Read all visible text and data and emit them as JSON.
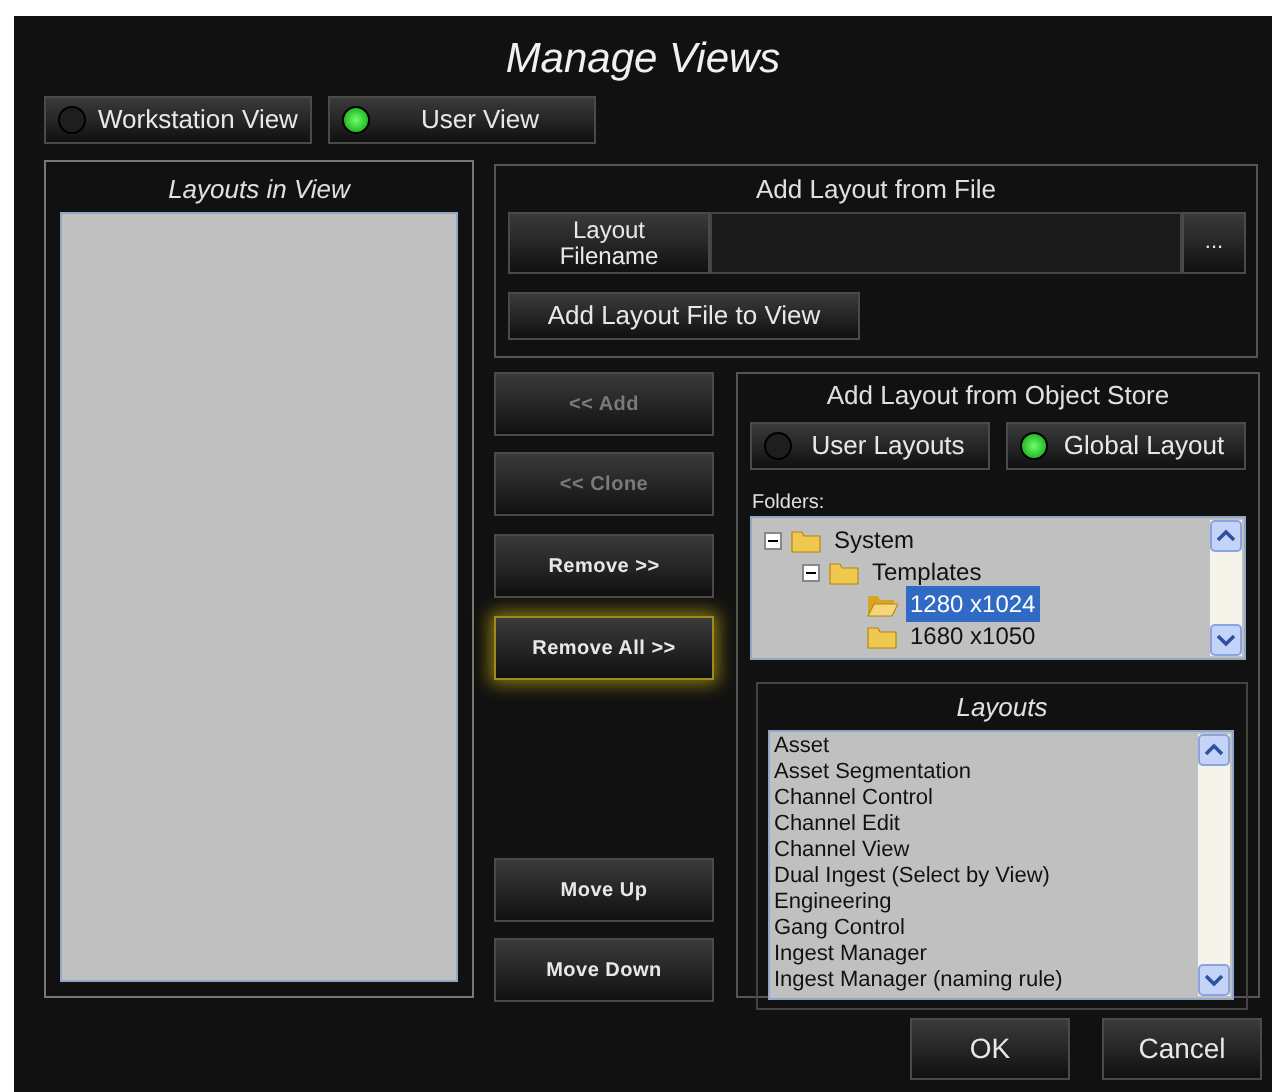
{
  "window": {
    "title": "Manage Views"
  },
  "view_toggles": [
    {
      "label": "Workstation View",
      "on": false
    },
    {
      "label": "User View",
      "on": true
    }
  ],
  "layouts_in_view": {
    "title": "Layouts in View"
  },
  "add_from_file": {
    "title": "Add Layout from File",
    "filename_button": "Layout Filename",
    "browse_button": "...",
    "add_button": "Add Layout File to View"
  },
  "action_buttons": [
    {
      "label": "<< Add",
      "disabled": true,
      "focused": false
    },
    {
      "label": "<< Clone",
      "disabled": true,
      "focused": false
    },
    {
      "label": "Remove >>",
      "disabled": false,
      "focused": false
    },
    {
      "label": "Remove All >>",
      "disabled": false,
      "focused": true
    },
    {
      "label": "Move Up",
      "disabled": false,
      "focused": false
    },
    {
      "label": "Move Down",
      "disabled": false,
      "focused": false
    }
  ],
  "object_store": {
    "title": "Add Layout from Object Store",
    "source_toggles": [
      {
        "label": "User Layouts",
        "on": false
      },
      {
        "label": "Global Layout",
        "on": true
      }
    ],
    "folders_label": "Folders:",
    "folders": [
      {
        "label": "System",
        "expanded": true,
        "selected": false,
        "children": [
          {
            "label": "Templates",
            "expanded": true,
            "selected": false,
            "children": [
              {
                "label": "1280 x1024",
                "selected": true
              },
              {
                "label": "1680 x1050",
                "selected": false
              }
            ]
          }
        ]
      }
    ],
    "layouts_title": "Layouts",
    "layouts": [
      "Asset",
      "Asset Segmentation",
      "Channel Control",
      "Channel Edit",
      "Channel View",
      "Dual Ingest (Select by View)",
      "Engineering",
      "Gang Control",
      "Ingest Manager",
      "Ingest Manager (naming rule)"
    ]
  },
  "dialog_buttons": [
    "OK",
    "Cancel"
  ]
}
